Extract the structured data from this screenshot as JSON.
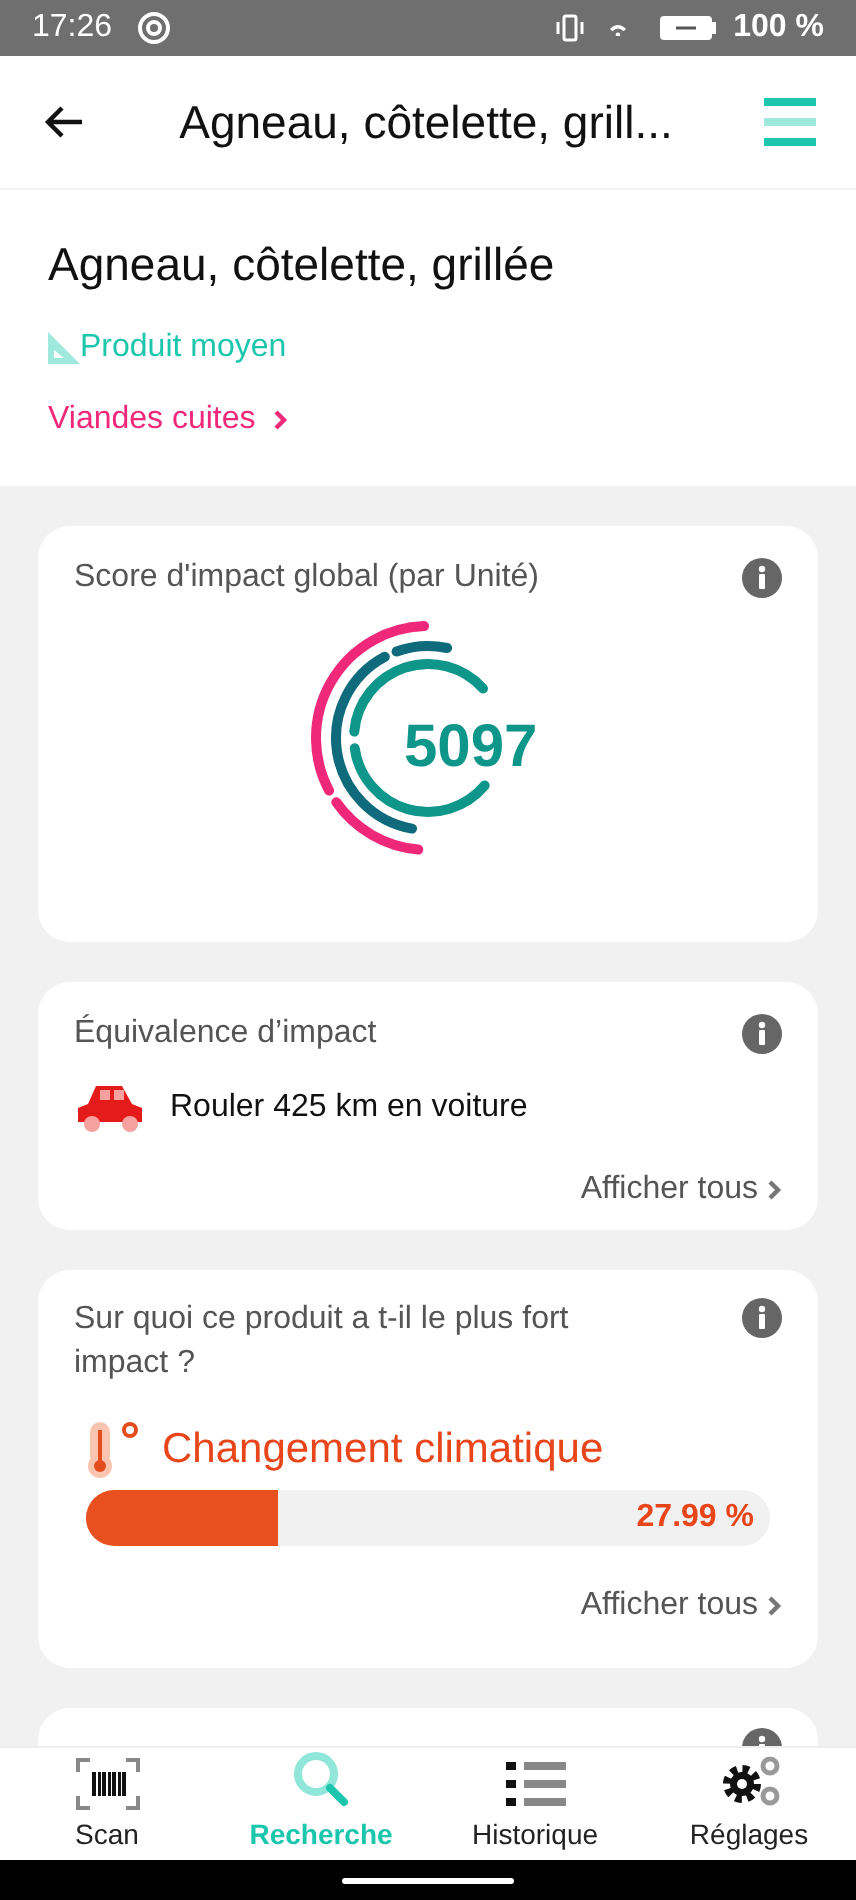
{
  "status_bar": {
    "time": "17:26",
    "battery": "100 %"
  },
  "header": {
    "title": "Agneau, côtelette, grill..."
  },
  "product": {
    "name": "Agneau, côtelette, grillée",
    "quality": "Produit moyen",
    "category": "Viandes cuites"
  },
  "score_card": {
    "title": "Score d'impact global (par Unité)",
    "score": "5097"
  },
  "equivalence_card": {
    "title": "Équivalence d’impact",
    "item": "Rouler 425 km en voiture",
    "link": "Afficher tous"
  },
  "impact_card": {
    "title": "Sur quoi ce produit a t-il le plus fort impact ?",
    "category": "Changement climatique",
    "level": 0.2799,
    "reading": "27.99 %",
    "link": "Afficher tous"
  },
  "bottom_nav": [
    {
      "label": "Scan",
      "kind": "scan",
      "selected": false
    },
    {
      "label": "Recherche",
      "kind": "search",
      "selected": true
    },
    {
      "label": "Historique",
      "kind": "list",
      "selected": false
    },
    {
      "label": "Réglages",
      "kind": "settings",
      "selected": false
    }
  ]
}
